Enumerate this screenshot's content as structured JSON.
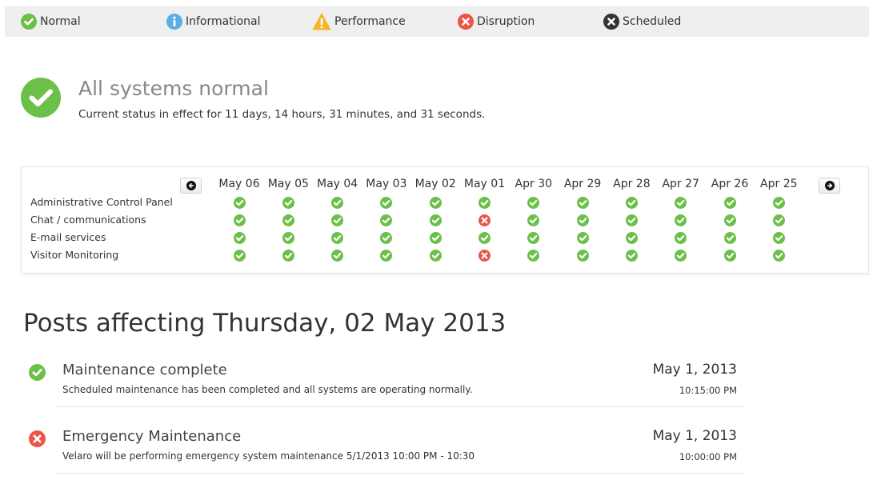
{
  "colors": {
    "normal": "#6cc04a",
    "informational": "#5aaee6",
    "performance": "#f5b52d",
    "disruption": "#ea5545",
    "scheduled": "#333333"
  },
  "legend": [
    {
      "label": "Normal",
      "icon": "check-circle-icon",
      "kind": "normal"
    },
    {
      "label": "Informational",
      "icon": "info-circle-icon",
      "kind": "informational"
    },
    {
      "label": "Performance",
      "icon": "warning-triangle-icon",
      "kind": "performance"
    },
    {
      "label": "Disruption",
      "icon": "x-circle-icon",
      "kind": "disruption"
    },
    {
      "label": "Scheduled",
      "icon": "x-circle-dark-icon",
      "kind": "scheduled"
    }
  ],
  "status": {
    "title": "All systems normal",
    "subtitle": "Current status in effect for 11 days, 14 hours, 31 minutes, and 31 seconds.",
    "icon": "check-circle-icon"
  },
  "grid": {
    "prev_icon": "arrow-left-icon",
    "next_icon": "arrow-right-icon",
    "dates": [
      "May 06",
      "May 05",
      "May 04",
      "May 03",
      "May 02",
      "May 01",
      "Apr 30",
      "Apr 29",
      "Apr 28",
      "Apr 27",
      "Apr 26",
      "Apr 25"
    ],
    "rows": [
      {
        "label": "Administrative Control Panel",
        "statuses": [
          "normal",
          "normal",
          "normal",
          "normal",
          "normal",
          "normal",
          "normal",
          "normal",
          "normal",
          "normal",
          "normal",
          "normal"
        ]
      },
      {
        "label": "Chat / communications",
        "statuses": [
          "normal",
          "normal",
          "normal",
          "normal",
          "normal",
          "disruption",
          "normal",
          "normal",
          "normal",
          "normal",
          "normal",
          "normal"
        ]
      },
      {
        "label": "E-mail services",
        "statuses": [
          "normal",
          "normal",
          "normal",
          "normal",
          "normal",
          "normal",
          "normal",
          "normal",
          "normal",
          "normal",
          "normal",
          "normal"
        ]
      },
      {
        "label": "Visitor Monitoring",
        "statuses": [
          "normal",
          "normal",
          "normal",
          "normal",
          "normal",
          "disruption",
          "normal",
          "normal",
          "normal",
          "normal",
          "normal",
          "normal"
        ]
      }
    ]
  },
  "posts": {
    "title": "Posts affecting Thursday, 02 May 2013",
    "items": [
      {
        "title": "Maintenance complete",
        "body": "Scheduled maintenance has been completed and all systems are operating normally.",
        "date": "May 1, 2013",
        "time": "10:15:00 PM",
        "kind": "normal"
      },
      {
        "title": "Emergency Maintenance",
        "body": "Velaro will be performing emergency system maintenance 5/1/2013 10:00 PM - 10:30",
        "date": "May 1, 2013",
        "time": "10:00:00 PM",
        "kind": "disruption"
      }
    ]
  }
}
